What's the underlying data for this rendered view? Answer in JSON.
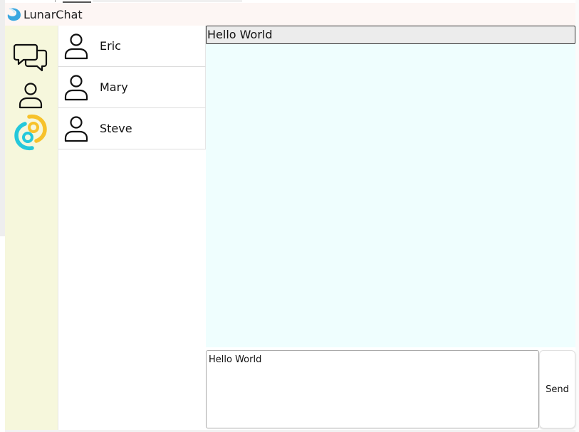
{
  "app": {
    "title": "LunarChat",
    "accent_colors": {
      "logo_blue": "#3aa7e0",
      "nav_bg": "#f6f7dc",
      "chat_bg": "#effefe",
      "titlebar_bg": "#fdf6f4"
    }
  },
  "nav": {
    "items": [
      {
        "icon": "chat-bubbles-icon"
      },
      {
        "icon": "person-icon"
      },
      {
        "icon": "tauri-logo-icon"
      }
    ]
  },
  "contacts": [
    {
      "name": "Eric"
    },
    {
      "name": "Mary"
    },
    {
      "name": "Steve"
    }
  ],
  "chat": {
    "header": "Hello World"
  },
  "composer": {
    "value": "Hello World",
    "send_label": "Send"
  }
}
